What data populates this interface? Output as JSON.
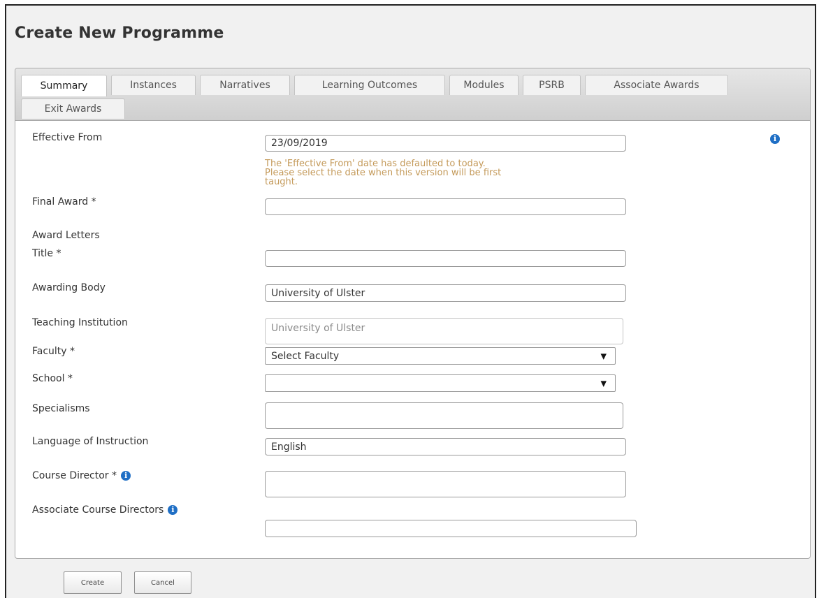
{
  "page": {
    "title": "Create New Programme"
  },
  "tabs": [
    {
      "label": "Summary",
      "active": true
    },
    {
      "label": "Instances"
    },
    {
      "label": "Narratives"
    },
    {
      "label": "Learning Outcomes"
    },
    {
      "label": "Modules"
    },
    {
      "label": "PSRB"
    },
    {
      "label": "Associate Awards"
    },
    {
      "label": "Exit Awards"
    }
  ],
  "form": {
    "effective_from": {
      "label": "Effective From",
      "value": "23/09/2019",
      "hint_line1": "The 'Effective From' date has defaulted to today.",
      "hint_line2": "Please select the date when this version will be first",
      "hint_line3": "taught."
    },
    "final_award": {
      "label": "Final Award *",
      "value": ""
    },
    "award_letters": {
      "label": "Award Letters"
    },
    "title": {
      "label": "Title *",
      "value": ""
    },
    "awarding_body": {
      "label": "Awarding Body",
      "value": "University of Ulster"
    },
    "teaching_institution": {
      "label": "Teaching Institution",
      "value": "University of Ulster"
    },
    "faculty": {
      "label": "Faculty *",
      "selected": "Select Faculty"
    },
    "school": {
      "label": "School *",
      "selected": ""
    },
    "specialisms": {
      "label": "Specialisms",
      "value": ""
    },
    "language": {
      "label": "Language of Instruction",
      "value": "English"
    },
    "course_director": {
      "label": "Course Director *",
      "value": ""
    },
    "associate_directors": {
      "label": "Associate Course Directors",
      "value": ""
    }
  },
  "icons": {
    "info": "info-icon",
    "dropdown_arrow": "▼",
    "info_glyph": "i"
  },
  "buttons": {
    "create": "Create",
    "cancel": "Cancel"
  },
  "colors": {
    "hint": "#c49a5a",
    "info": "#1f6fc5"
  }
}
